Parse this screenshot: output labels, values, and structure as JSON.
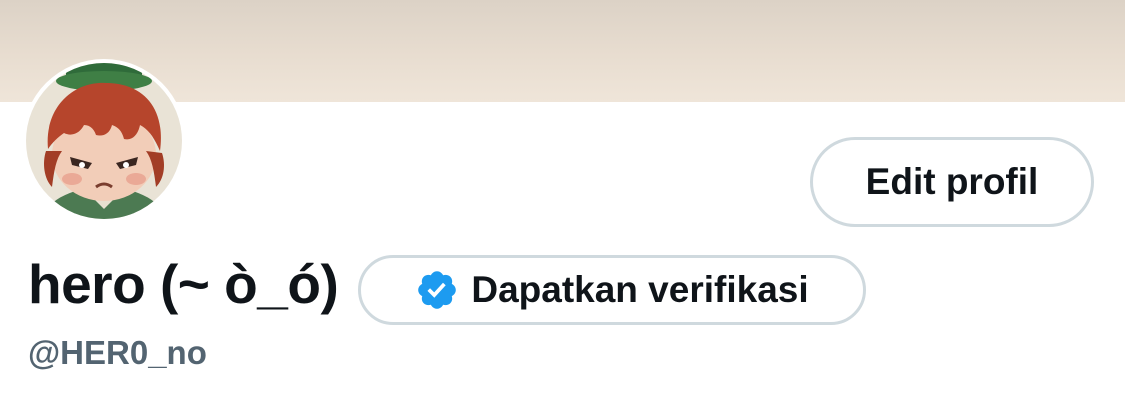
{
  "profile": {
    "display_name": "hero (~ ò_ó)",
    "handle": "@HER0_no",
    "edit_button_label": "Edit profil",
    "verify_button_label": "Dapatkan verifikasi",
    "verify_icon": "verified-badge-icon",
    "avatar_icon": "profile-avatar"
  },
  "colors": {
    "text_primary": "#0f1419",
    "text_secondary": "#536471",
    "border": "#cfd9de",
    "verified_blue": "#1d9bf0",
    "banner": "#e8ddd0"
  }
}
